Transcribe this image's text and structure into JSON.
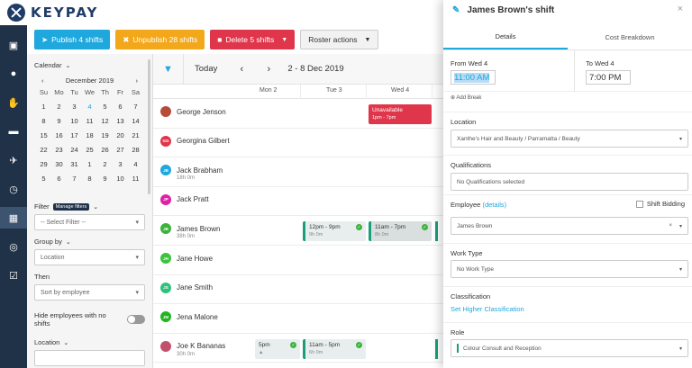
{
  "app": {
    "logo_text": "KEYPAY"
  },
  "toolbar": {
    "publish_label": "Publish 4 shifts",
    "unpublish_label": "Unpublish 28 shifts",
    "delete_label": "Delete 5 shifts",
    "roster_actions_label": "Roster actions"
  },
  "sidebar": {
    "calendar_label": "Calendar",
    "month": "December 2019",
    "prev": "‹",
    "next": "›",
    "dow": [
      "Su",
      "Mo",
      "Tu",
      "We",
      "Th",
      "Fr",
      "Sa"
    ],
    "days": [
      "1",
      "2",
      "3",
      "4",
      "5",
      "6",
      "7",
      "8",
      "9",
      "10",
      "11",
      "12",
      "13",
      "14",
      "15",
      "16",
      "17",
      "18",
      "19",
      "20",
      "21",
      "22",
      "23",
      "24",
      "25",
      "26",
      "27",
      "28",
      "29",
      "30",
      "31",
      "1",
      "2",
      "3",
      "4",
      "5",
      "6",
      "7",
      "8",
      "9",
      "10",
      "11"
    ],
    "today_day": "4",
    "filter_label": "Filter",
    "manage_filters": "Manage filters",
    "filter_placeholder": "-- Select Filter --",
    "group_by_label": "Group by",
    "group_by_value": "Location",
    "then_label": "Then",
    "then_value": "Sort by employee",
    "hide_label": "Hide employees with no shifts",
    "location_label": "Location"
  },
  "roster": {
    "today": "Today",
    "prev": "‹",
    "next": "›",
    "range": "2 - 8 Dec 2019",
    "days": [
      "Mon 2",
      "Tue 3",
      "Wed 4"
    ],
    "employees": [
      {
        "name": "George Jenson",
        "hours": "",
        "initials": "",
        "color": "#b84a3a"
      },
      {
        "name": "Georgina Gilbert",
        "hours": "",
        "initials": "GG",
        "color": "#e0364b"
      },
      {
        "name": "Jack Brabham",
        "hours": "18h 0m",
        "initials": "JB",
        "color": "#1ea8dd"
      },
      {
        "name": "Jack Pratt",
        "hours": "",
        "initials": "JP",
        "color": "#e021a8"
      },
      {
        "name": "James Brown",
        "hours": "38h 0m",
        "initials": "JB",
        "color": "#3cb23c"
      },
      {
        "name": "Jane Howe",
        "hours": "",
        "initials": "JH",
        "color": "#3cc23c"
      },
      {
        "name": "Jane Smith",
        "hours": "",
        "initials": "JS",
        "color": "#2ec27e"
      },
      {
        "name": "Jena Malone",
        "hours": "",
        "initials": "JM",
        "color": "#22b522"
      },
      {
        "name": "Joe K Bananas",
        "hours": "30h 0m",
        "initials": "",
        "color": "#c0506b"
      }
    ],
    "unavailable": {
      "title": "Unavailable",
      "time": "1pm - 7pm"
    },
    "shifts": {
      "jb_tue": {
        "time": "12pm - 9pm",
        "dur": "9h 0m"
      },
      "jb_wed": {
        "time": "11am - 7pm",
        "dur": "8h 0m"
      },
      "joe_mon": {
        "time": "5pm"
      },
      "joe_tue": {
        "time": "11am - 5pm",
        "dur": "6h 0m"
      }
    }
  },
  "panel": {
    "title": "James Brown's shift",
    "close": "×",
    "tab_details": "Details",
    "tab_cost": "Cost Breakdown",
    "from_label": "From Wed 4",
    "from_time": "11:00 AM",
    "to_label": "To Wed 4",
    "to_time": "7:00 PM",
    "add_break": "Add Break",
    "location_label": "Location",
    "location_value": "Xanthe's Hair and Beauty / Parramatta / Beauty",
    "qualifications_label": "Qualifications",
    "qualifications_value": "No Qualifications selected",
    "employee_label": "Employee",
    "employee_details": "(details)",
    "shift_bidding": "Shift Bidding",
    "employee_value": "James Brown",
    "work_type_label": "Work Type",
    "work_type_value": "No Work Type",
    "classification_label": "Classification",
    "classification_link": "Set Higher Classification",
    "role_label": "Role",
    "role_value": "Colour Consult and Reception"
  }
}
